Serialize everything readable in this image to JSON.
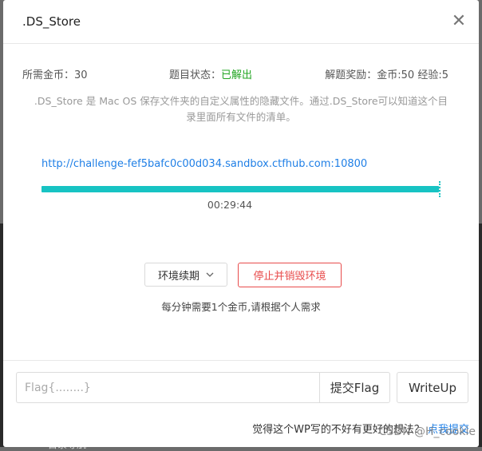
{
  "modal": {
    "title": ".DS_Store",
    "close_glyph": "✕"
  },
  "stats": {
    "coins_required": "所需金币：30",
    "status_label": "题目状态：",
    "status_value": "已解出",
    "reward": "解题奖励：金币:50 经验:5"
  },
  "description": ".DS_Store 是 Mac OS 保存文件夹的自定义属性的隐藏文件。通过.DS_Store可以知道这个目录里面所有文件的清单。",
  "environment": {
    "url": "http://challenge-fef5bafc0c00d034.sandbox.ctfhub.com:10800",
    "progress_fraction": 0.996,
    "timer": "00:29:44",
    "accent_color": "#17c3c3"
  },
  "actions": {
    "renew_label": "环境续期",
    "renew_icon": "chevron-down-icon",
    "destroy_label": "停止并销毁环境",
    "hint": "每分钟需要1个金币,请根据个人需求"
  },
  "flag": {
    "placeholder": "Flag{........}",
    "value": "",
    "submit_label": "提交Flag",
    "writeup_label": "WriteUp"
  },
  "footer": {
    "question": "觉得这个WP写的不好有更好的想法？",
    "link": "点我提交"
  },
  "watermark": "CSDN @H_cookie",
  "background": {
    "peek_text": "目录导航"
  }
}
